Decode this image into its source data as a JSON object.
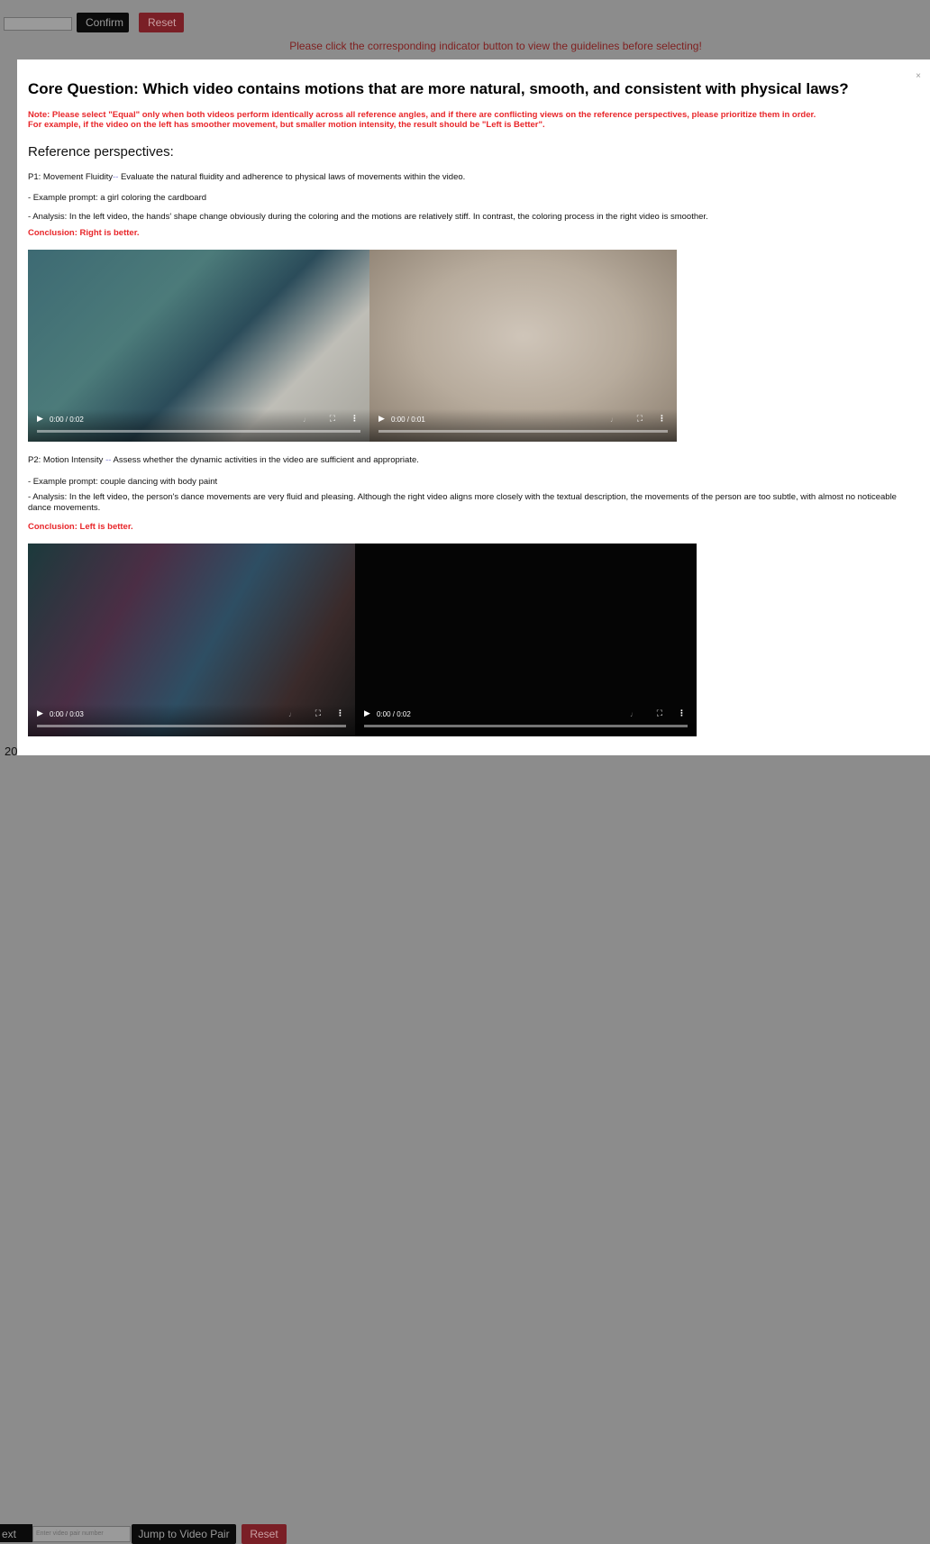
{
  "background": {
    "confirm_label": "Confirm",
    "reset_label": "Reset",
    "guideline_note": "Please click the corresponding indicator button to view the guidelines before selecting!",
    "year_fragment": "20",
    "next_label": "ext",
    "jump_placeholder": "Enter video pair number",
    "jump_label": "Jump to Video Pair",
    "reset2_label": "Reset"
  },
  "modal": {
    "close_label": "×",
    "title": "Core Question: Which video contains motions that are more natural, smooth, and consistent with physical laws?",
    "note_line1": "Note: Please select \"Equal\" only when both videos perform identically across all reference angles, and if there are conflicting views on the reference perspectives, please prioritize them in order.",
    "note_line2": "For example, if the video on the left has smoother movement, but smaller motion intensity, the result should be \"Left is Better\".",
    "ref_heading": "Reference perspectives:",
    "p1": {
      "name": "P1: Movement Fluidity",
      "dash": "--",
      "desc": " Evaluate the natural fluidity and adherence to physical laws of movements within the video.",
      "prompt": "- Example prompt: a girl coloring the cardboard",
      "analysis": "- Analysis: In the left video, the hands' shape change obviously during the coloring and the motions are relatively stiff. In contrast, the coloring process in the right video is smoother.",
      "conclusion": "Conclusion: Right is better.",
      "left_time": "0:00 / 0:02",
      "right_time": "0:00 / 0:01"
    },
    "p2": {
      "name": "P2: Motion Intensity ",
      "dash": "--",
      "desc": " Assess whether the dynamic activities in the video are sufficient and appropriate.",
      "prompt": "- Example prompt: couple dancing with body paint",
      "analysis": "- Analysis: In the left video, the person's dance movements are very fluid and pleasing. Although the right video aligns more closely with the textual description, the movements of the person are too subtle, with almost no noticeable dance movements.",
      "conclusion": "Conclusion: Left is better.",
      "left_time": "0:00 / 0:03",
      "right_time": "0:00 / 0:02"
    }
  },
  "icons": {
    "play": "play-icon",
    "volume": "volume-icon",
    "fullscreen": "fullscreen-icon",
    "more": "more-options-icon"
  },
  "colors": {
    "accent_red": "#e8262a",
    "overlay": "#8c8c8c",
    "modal_bg": "#ffffff"
  }
}
